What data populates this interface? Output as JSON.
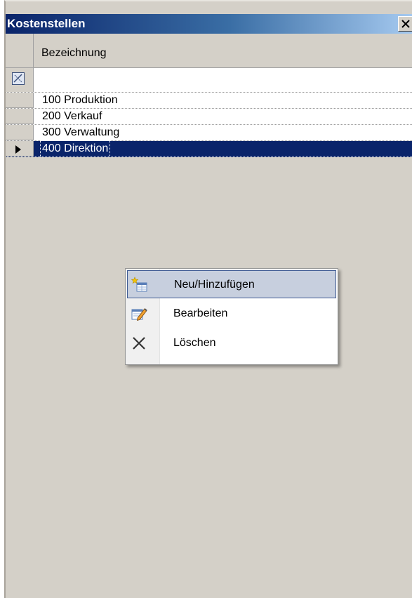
{
  "window": {
    "title": "Kostenstellen",
    "close_label": "X"
  },
  "grid": {
    "column_header": "Bezeichnung",
    "filter_value": "",
    "rows": [
      {
        "label": "100 Produktion"
      },
      {
        "label": "200 Verkauf"
      },
      {
        "label": "300 Verwaltung"
      },
      {
        "label": "400 Direktion",
        "selected": true
      }
    ]
  },
  "context_menu": {
    "items": [
      {
        "label": "Neu/Hinzufügen",
        "icon": "new-add-icon",
        "highlighted": true
      },
      {
        "label": "Bearbeiten",
        "icon": "edit-icon"
      },
      {
        "label": "Löschen",
        "icon": "delete-x-icon"
      }
    ]
  },
  "colors": {
    "title_bar": "#0a246a",
    "selection": "#0a246a",
    "background": "#d4d0c8",
    "menu_highlight": "#c7cfde"
  }
}
